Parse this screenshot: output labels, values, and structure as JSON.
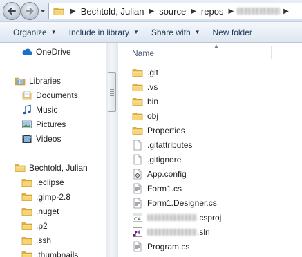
{
  "address": {
    "path": [
      "Bechtold, Julian",
      "source",
      "repos"
    ]
  },
  "toolbar": {
    "organize": "Organize",
    "include_in_library": "Include in library",
    "share_with": "Share with",
    "new_folder": "New folder"
  },
  "nav": {
    "onedrive": "OneDrive",
    "libraries": "Libraries",
    "documents": "Documents",
    "music": "Music",
    "pictures": "Pictures",
    "videos": "Videos",
    "user": "Bechtold, Julian",
    "folders": [
      ".eclipse",
      ".gimp-2.8",
      ".nuget",
      ".p2",
      ".ssh",
      ".thumbnails"
    ]
  },
  "content": {
    "column_name": "Name",
    "items": [
      {
        "name": ".git",
        "icon": "folder-icon"
      },
      {
        "name": ".vs",
        "icon": "folder-icon"
      },
      {
        "name": "bin",
        "icon": "folder-icon"
      },
      {
        "name": "obj",
        "icon": "folder-icon"
      },
      {
        "name": "Properties",
        "icon": "folder-icon"
      },
      {
        "name": ".gitattributes",
        "icon": "file-icon"
      },
      {
        "name": ".gitignore",
        "icon": "file-icon"
      },
      {
        "name": "App.config",
        "icon": "config-file-icon"
      },
      {
        "name": "Form1.cs",
        "icon": "cs-file-icon"
      },
      {
        "name": "Form1.Designer.cs",
        "icon": "cs-file-icon"
      },
      {
        "name": ".csproj",
        "icon": "csproj-file-icon"
      },
      {
        "name": ".sln",
        "icon": "sln-file-icon"
      },
      {
        "name": "Program.cs",
        "icon": "cs-file-icon"
      }
    ]
  },
  "colors": {
    "command_text": "#1e395b",
    "column_header_text": "#4c607a",
    "folder_yellow": "#f4c95d"
  }
}
